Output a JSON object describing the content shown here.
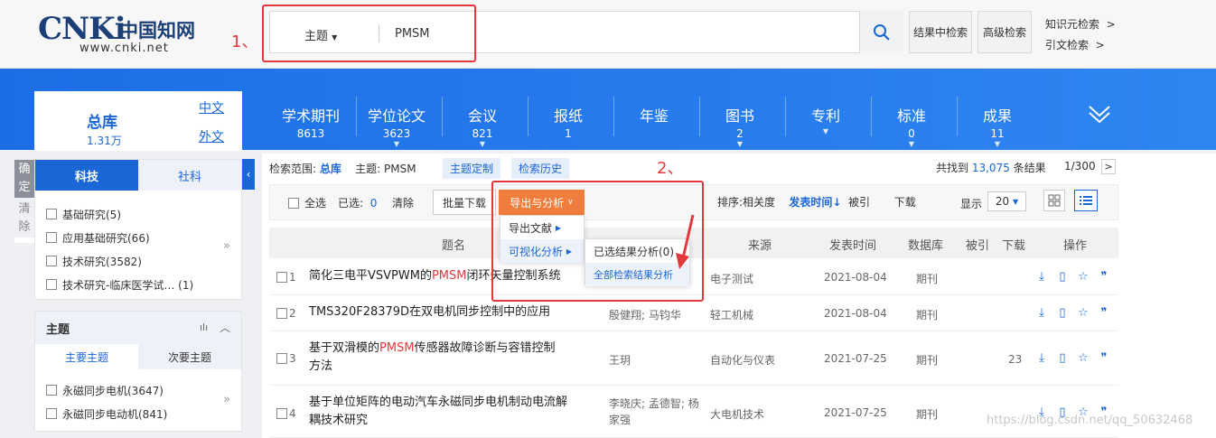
{
  "logo": {
    "main": "CNKi",
    "cn": "中国知网",
    "url": "www.cnki.net"
  },
  "annotations": {
    "step1": "1、",
    "step2": "2、"
  },
  "search": {
    "type": "主题",
    "query": "PMSM"
  },
  "header_buttons": {
    "within": "结果中检索",
    "advanced": "高级检索"
  },
  "header_links": {
    "knowledge": "知识元检索",
    "citation": "引文检索",
    "arrow": ">"
  },
  "zongku": {
    "title": "总库",
    "count": "1.31万",
    "cn": "中文",
    "foreign": "外文"
  },
  "databases": [
    {
      "name": "学术期刊",
      "count": "8613",
      "arrow": ""
    },
    {
      "name": "学位论文",
      "count": "3623",
      "arrow": "▼"
    },
    {
      "name": "会议",
      "count": "821",
      "arrow": "▼"
    },
    {
      "name": "报纸",
      "count": "1",
      "arrow": ""
    },
    {
      "name": "年鉴",
      "count": "",
      "arrow": ""
    },
    {
      "name": "图书",
      "count": "2",
      "arrow": "▼"
    },
    {
      "name": "专利",
      "count": "",
      "arrow": "▼"
    },
    {
      "name": "标准",
      "count": "0",
      "arrow": "▼"
    },
    {
      "name": "成果",
      "count": "11",
      "arrow": "▼"
    }
  ],
  "sidebar": {
    "confirm": "确定",
    "clear": "清除",
    "tabs": [
      "科技",
      "社科"
    ],
    "items": [
      "基础研究(5)",
      "应用基础研究(66)",
      "技术研究(3582)",
      "技术研究-临床医学试… (1)"
    ],
    "topic_title": "主题",
    "topic_tabs": [
      "主要主题",
      "次要主题"
    ],
    "topic_items": [
      "永磁同步电机(3647)",
      "永磁同步电动机(841)"
    ],
    "more": "»"
  },
  "crumb": {
    "scope_label": "检索范围:",
    "scope_value": "总库",
    "topic_label": "主题:",
    "topic_value": "PMSM",
    "custom": "主题定制",
    "history": "检索历史"
  },
  "result_info": {
    "prefix": "共找到",
    "count": "13,075",
    "suffix": "条结果",
    "page": "1/300",
    "next": ">"
  },
  "toolbar": {
    "select_all": "全选",
    "selected_label": "已选:",
    "selected_count": "0",
    "clear": "清除",
    "batch_download": "批量下载",
    "export": "导出与分析",
    "sort_label": "排序:",
    "sort_relevance": "相关度",
    "sort_date": "发表时间",
    "sort_cited": "被引",
    "sort_download": "下载",
    "display_label": "显示",
    "display_value": "20"
  },
  "dropdown": {
    "export_doc": "导出文献",
    "visual": "可视化分析",
    "selected_analysis": "已选结果分析(0)",
    "all_analysis": "全部检索结果分析"
  },
  "table": {
    "headers": [
      "题名",
      "来源",
      "发表时间",
      "数据库",
      "被引",
      "下载",
      "操作"
    ],
    "rows": [
      {
        "num": "1",
        "pre": "简化三电平VSVPWM的",
        "hl": "PMSM",
        "post": "闭环矢量控制系统",
        "post2": "",
        "authors": "",
        "source": "电子测试",
        "date": "2021-08-04",
        "db": "期刊",
        "cited": ""
      },
      {
        "num": "2",
        "pre": "TMS320F28379D在双电机同步控制中的应用",
        "hl": "",
        "post": "",
        "post2": "",
        "authors": "殷健翔; 马钧华",
        "source": "轻工机械",
        "date": "2021-08-04",
        "db": "期刊",
        "cited": ""
      },
      {
        "num": "3",
        "pre": "基于双滑模的",
        "hl": "PMSM",
        "post": "传感器故障诊断与容错控制",
        "post2": "方法",
        "authors": "王玥",
        "source": "自动化与仪表",
        "date": "2021-07-25",
        "db": "期刊",
        "cited": "23"
      },
      {
        "num": "4",
        "pre": "基于单位矩阵的电动汽车永磁同步电机制动电流解",
        "hl": "",
        "post": "",
        "post2": "耦技术研究",
        "authors": "李晓庆; 孟德智; 杨家强",
        "source": "大电机技术",
        "date": "2021-07-25",
        "db": "期刊",
        "cited": ""
      }
    ]
  },
  "watermark": "https://blog.csdn.net/qq_50632468",
  "colors": {
    "primary": "#1a66d6",
    "orange": "#f07d3b",
    "red": "#e4393c"
  }
}
